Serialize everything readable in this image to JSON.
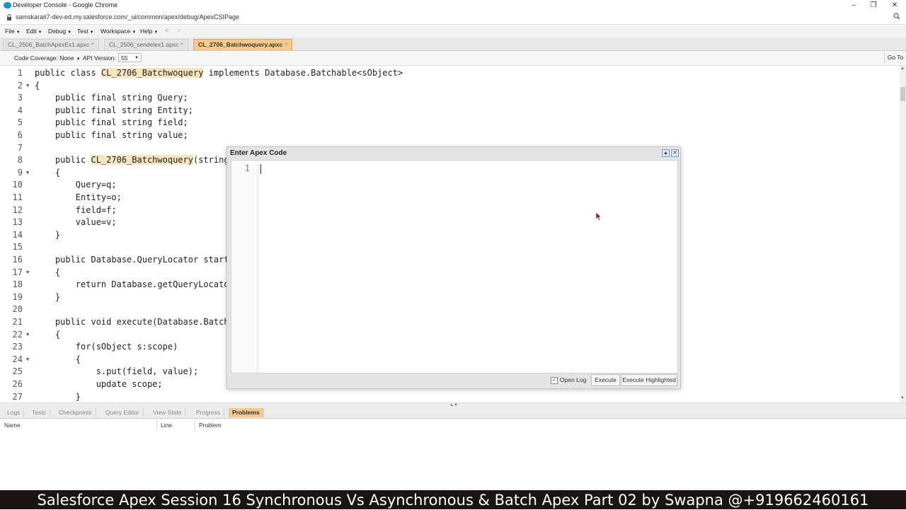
{
  "browser": {
    "window_title": "Developer Console - Google Chrome",
    "url": "samskarait7-dev-ed.my.salesforce.com/_ui/common/apex/debug/ApexCSIPage",
    "minimize": "–",
    "restore": "❐",
    "close": "✕"
  },
  "menubar": {
    "items": [
      "File",
      "Edit",
      "Debug",
      "Test",
      "Workspace",
      "Help"
    ],
    "back": "<",
    "forward": ">"
  },
  "tabs": [
    {
      "label": "CL_2506_BatchApexEx1.apxc",
      "active": false
    },
    {
      "label": "CL_2506_sendelex1.apxc",
      "active": false
    },
    {
      "label": "CL_2706_Batchwoquery.apxc",
      "active": true
    }
  ],
  "toolbar": {
    "code_coverage": "Code Coverage: None",
    "api_version_label": "API Version:",
    "api_version_value": "55",
    "go_to": "Go To"
  },
  "editor": {
    "lines": [
      {
        "n": "1",
        "fold": "",
        "code": "public class CL_2706_Batchwoquery implements Database.Batchable<sObject>"
      },
      {
        "n": "2",
        "fold": "▼",
        "code": "{"
      },
      {
        "n": "3",
        "fold": "",
        "code": "    public final string Query;"
      },
      {
        "n": "4",
        "fold": "",
        "code": "    public final string Entity;"
      },
      {
        "n": "5",
        "fold": "",
        "code": "    public final string field;"
      },
      {
        "n": "6",
        "fold": "",
        "code": "    public final string value;"
      },
      {
        "n": "7",
        "fold": "",
        "code": ""
      },
      {
        "n": "8",
        "fold": "",
        "code": "    public CL_2706_Batchwoquery(string"
      },
      {
        "n": "9",
        "fold": "▼",
        "code": "    {"
      },
      {
        "n": "10",
        "fold": "",
        "code": "        Query=q;"
      },
      {
        "n": "11",
        "fold": "",
        "code": "        Entity=o;"
      },
      {
        "n": "12",
        "fold": "",
        "code": "        field=f;"
      },
      {
        "n": "13",
        "fold": "",
        "code": "        value=v;"
      },
      {
        "n": "14",
        "fold": "",
        "code": "    }"
      },
      {
        "n": "15",
        "fold": "",
        "code": ""
      },
      {
        "n": "16",
        "fold": "",
        "code": "    public Database.QueryLocator start"
      },
      {
        "n": "17",
        "fold": "▼",
        "code": "    {"
      },
      {
        "n": "18",
        "fold": "",
        "code": "        return Database.getQueryLocato"
      },
      {
        "n": "19",
        "fold": "",
        "code": "    }"
      },
      {
        "n": "20",
        "fold": "",
        "code": ""
      },
      {
        "n": "21",
        "fold": "",
        "code": "    public void execute(Database.Batch"
      },
      {
        "n": "22",
        "fold": "▼",
        "code": "    {"
      },
      {
        "n": "23",
        "fold": "",
        "code": "        for(sObject s:scope)"
      },
      {
        "n": "24",
        "fold": "▼",
        "code": "        {"
      },
      {
        "n": "25",
        "fold": "",
        "code": "            s.put(field, value);"
      },
      {
        "n": "26",
        "fold": "",
        "code": "            update scope;"
      },
      {
        "n": "27",
        "fold": "",
        "code": "        }"
      }
    ],
    "class_name_highlight": "CL_2706_Batchwoquery"
  },
  "dialog": {
    "title": "Enter Apex Code",
    "line_number": "1",
    "open_log_label": "Open Log",
    "open_log_checked": true,
    "execute_label": "Execute",
    "execute_highlighted_label": "Execute Highlighted"
  },
  "bottom_panel": {
    "tabs": [
      {
        "label": "Logs",
        "active": false
      },
      {
        "label": "Tests",
        "active": false
      },
      {
        "label": "Checkpoints",
        "active": false
      },
      {
        "label": "Query Editor",
        "active": false
      },
      {
        "label": "View State",
        "active": false
      },
      {
        "label": "Progress",
        "active": false
      },
      {
        "label": "Problems",
        "active": true
      }
    ],
    "columns": [
      "Name",
      "Line",
      "Problem"
    ]
  },
  "caption": "Salesforce Apex Session 16 Synchronous Vs Asynchronous & Batch Apex Part 02 by Swapna @+919662460161",
  "colors": {
    "active_tab": "#f5c88b",
    "highlight": "#f6e5bf",
    "caption_bg": "#1a1412",
    "cursor": "#8b1a5a"
  }
}
